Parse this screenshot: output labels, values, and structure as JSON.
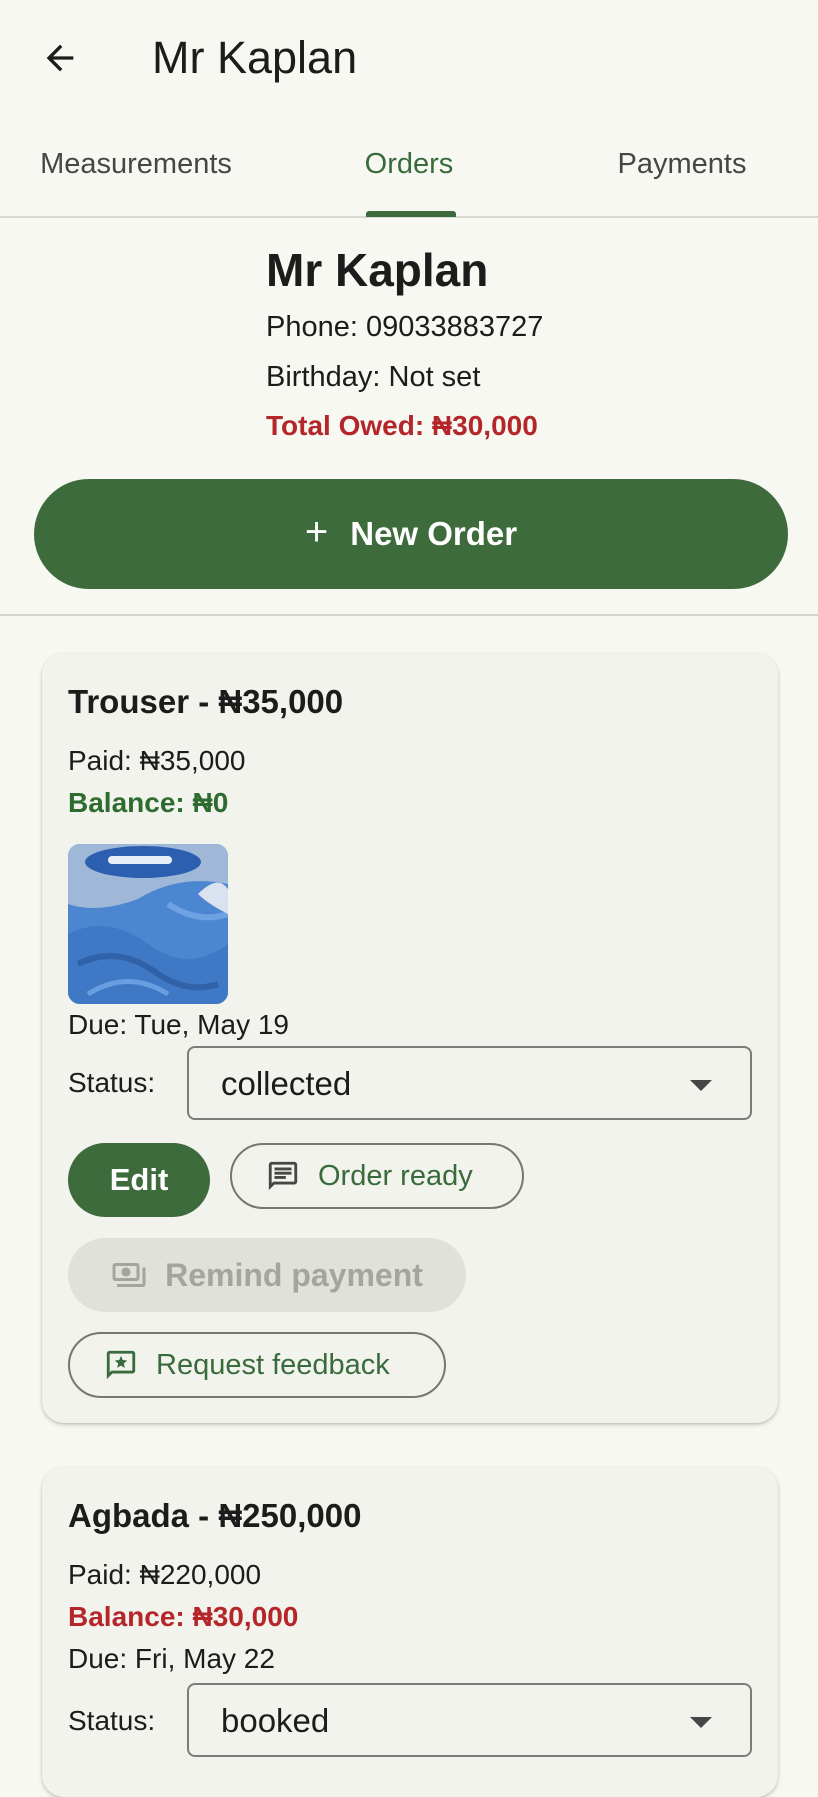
{
  "appbar": {
    "title": "Mr Kaplan"
  },
  "tabs": [
    {
      "label": "Measurements",
      "active": false
    },
    {
      "label": "Orders",
      "active": true
    },
    {
      "label": "Payments",
      "active": false
    }
  ],
  "customer": {
    "name": "Mr Kaplan",
    "phone": "Phone: 09033883727",
    "birthday": "Birthday: Not set",
    "total_owed": "Total Owed: ₦30,000"
  },
  "new_order_label": "New Order",
  "orders": [
    {
      "title": "Trouser - ₦35,000",
      "paid": "Paid: ₦35,000",
      "balance": "Balance: ₦0",
      "due": "Due: Tue, May 19",
      "status_label": "Status:",
      "status_value": "collected",
      "edit_label": "Edit",
      "order_ready_label": "Order ready",
      "remind_payment_label": "Remind payment",
      "request_feedback_label": "Request feedback"
    },
    {
      "title": "Agbada - ₦250,000",
      "paid": "Paid: ₦220,000",
      "balance": "Balance: ₦30,000",
      "due": "Due: Fri, May 22",
      "status_label": "Status:",
      "status_value": "booked"
    }
  ],
  "colors": {
    "primary": "#3d6b3b",
    "background": "#f6f8f1",
    "card": "#f1f3ec",
    "owed_red": "#b4262a",
    "balance_green": "#2e6b2e"
  },
  "icons": {
    "back": "arrow-back-icon",
    "add": "plus-icon",
    "message": "message-icon",
    "payment": "cash-icon",
    "feedback": "feedback-icon",
    "dropdown": "dropdown-arrow-icon"
  }
}
